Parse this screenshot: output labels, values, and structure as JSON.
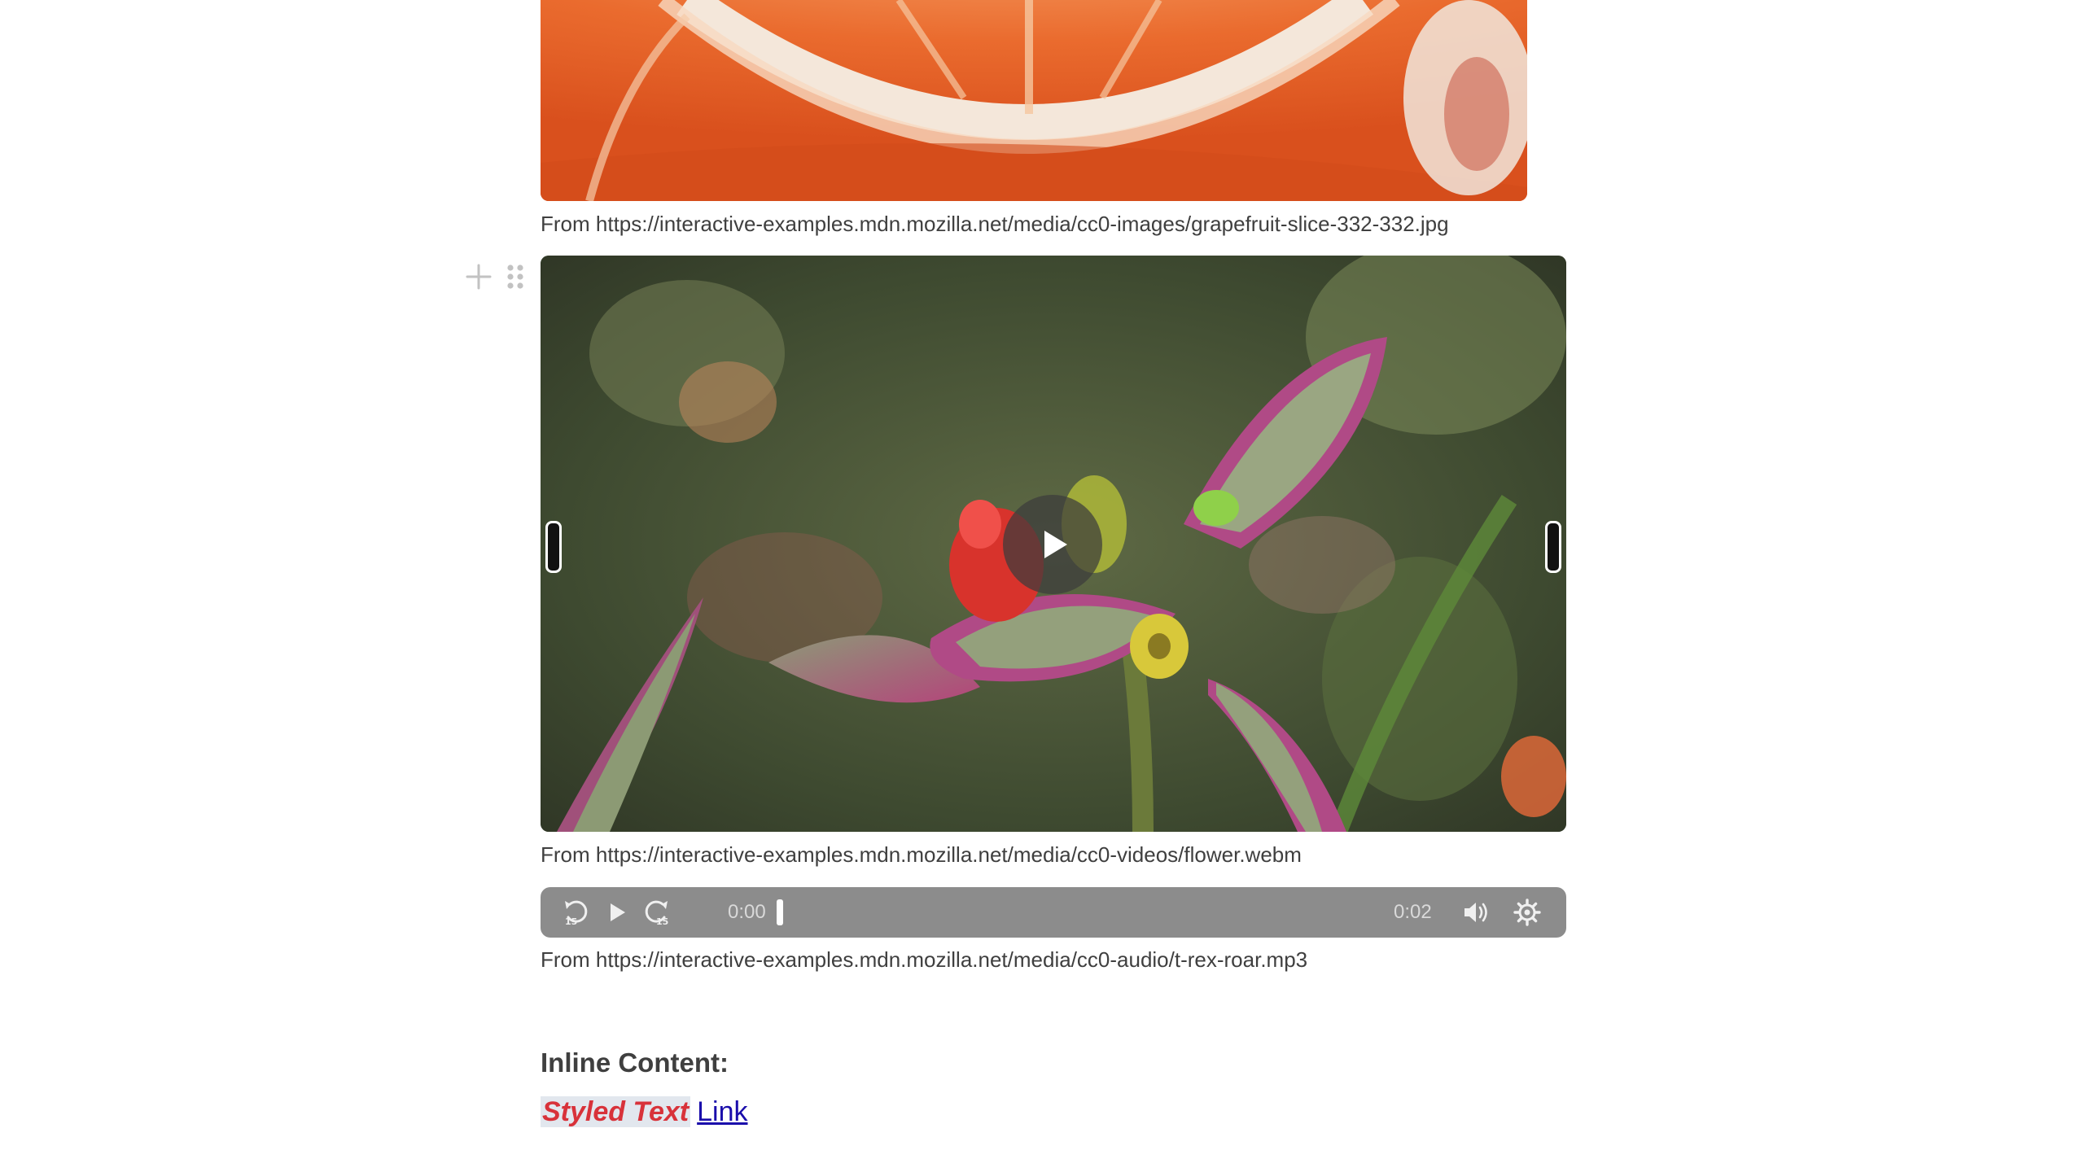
{
  "blocks": {
    "image": {
      "caption": "From https://interactive-examples.mdn.mozilla.net/media/cc0-images/grapefruit-slice-332-332.jpg"
    },
    "video": {
      "caption": "From https://interactive-examples.mdn.mozilla.net/media/cc0-videos/flower.webm",
      "play_icon": "play-icon"
    },
    "audio": {
      "caption": "From https://interactive-examples.mdn.mozilla.net/media/cc0-audio/t-rex-roar.mp3",
      "current_time": "0:00",
      "duration": "0:02",
      "progress": 0,
      "controls": [
        "rewind-15-icon",
        "play-icon",
        "forward-15-icon",
        "volume-icon",
        "settings-gear-icon"
      ]
    }
  },
  "side_menu": {
    "icons": [
      "plus-icon",
      "drag-handle-icon"
    ]
  },
  "inline_section": {
    "heading": "Inline Content:",
    "styled_text": "Styled Text",
    "link_text": "Link"
  },
  "colors": {
    "audio_bar": "#8c8c8c",
    "styled_text": "#d8323a",
    "styled_text_bg": "#e2e7ee",
    "link": "#1a0dab",
    "caption_text": "#3f3f3f"
  }
}
